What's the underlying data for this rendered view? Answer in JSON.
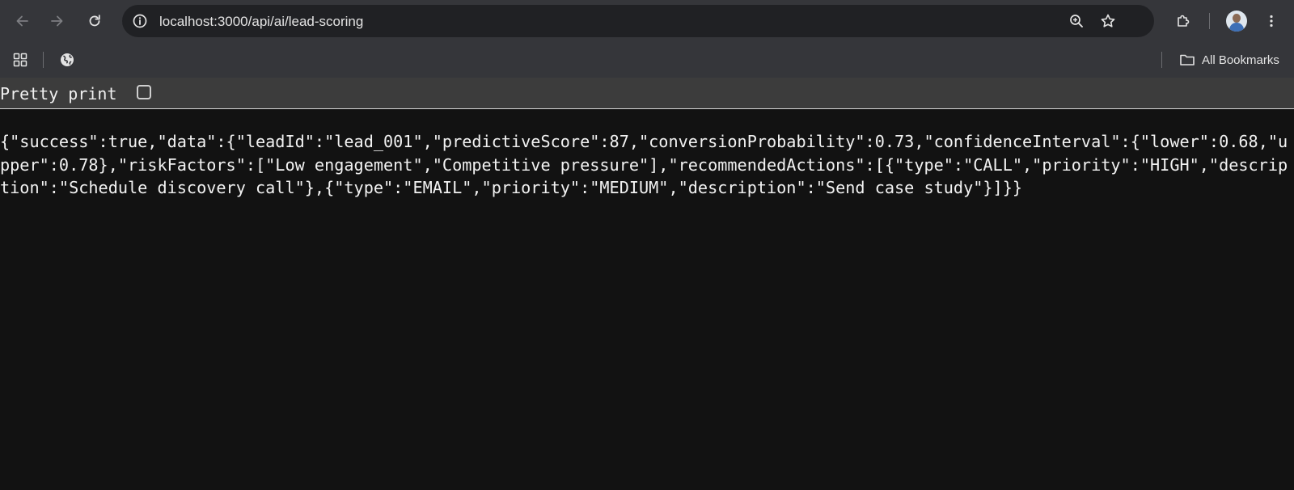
{
  "browser": {
    "url": "localhost:3000/api/ai/lead-scoring",
    "bookmarks_label": "All Bookmarks",
    "icons": {
      "back": "arrow-left-icon",
      "forward": "arrow-right-icon",
      "reload": "reload-icon",
      "site_info": "info-icon",
      "zoom": "zoom-in-icon",
      "bookmark_star": "star-icon",
      "extensions": "puzzle-icon",
      "profile": "avatar",
      "menu": "kebab-menu-icon",
      "apps": "apps-grid-icon",
      "globe": "globe-icon",
      "folder": "folder-icon"
    }
  },
  "viewer": {
    "pretty_print_label": "Pretty print",
    "pretty_print_checked": false
  },
  "json_text": "{\"success\":true,\"data\":{\"leadId\":\"lead_001\",\"predictiveScore\":87,\"conversionProbability\":0.73,\"confidenceInterval\":{\"lower\":0.68,\"upper\":0.78},\"riskFactors\":[\"Low engagement\",\"Competitive pressure\"],\"recommendedActions\":[{\"type\":\"CALL\",\"priority\":\"HIGH\",\"description\":\"Schedule discovery call\"},{\"type\":\"EMAIL\",\"priority\":\"MEDIUM\",\"description\":\"Send case study\"}]}}",
  "colors": {
    "toolbar_bg": "#35363a",
    "omnibox_bg": "#202124",
    "page_bg": "#121212",
    "pretty_print_bar_bg": "#3c3c3c",
    "text": "#f2f2f2"
  }
}
